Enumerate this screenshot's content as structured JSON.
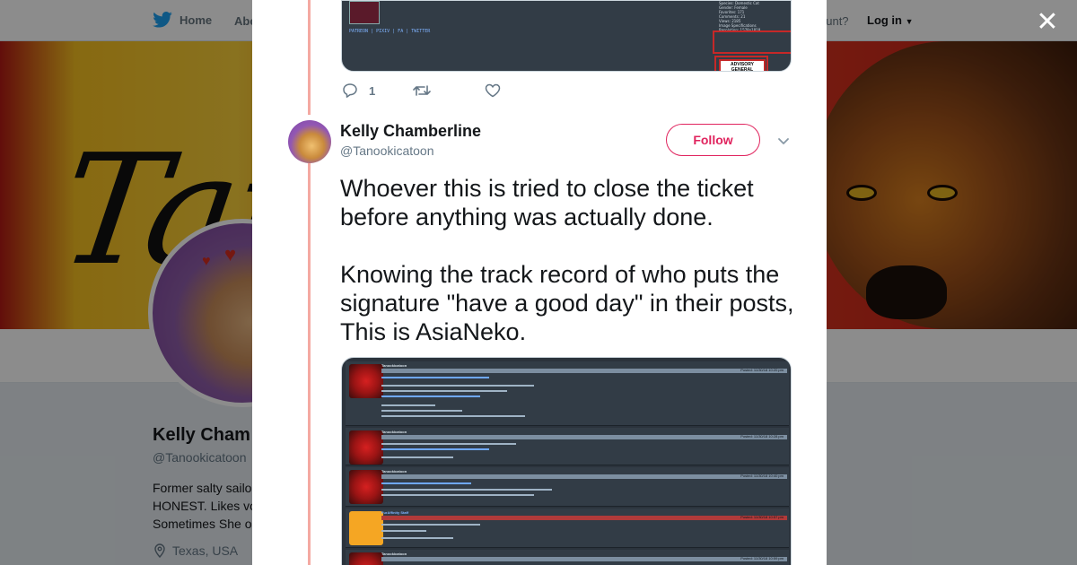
{
  "background": {
    "nav": {
      "home_label": "Home",
      "about_label": "Abo",
      "account_prompt": "ccount?",
      "login_label": "Log in"
    },
    "banner_text": "Tan",
    "profile": {
      "name": "Kelly Cham",
      "handle": "@Tanookicatoon",
      "bio_lines": [
        "Former salty sailo",
        "HONEST. Likes vo",
        "Sometimes She o"
      ],
      "location": "Texas, USA"
    }
  },
  "modal": {
    "close_label": "✕",
    "previous_tweet": {
      "media_links": "PATREON | PIXIV | FA | TWITTER",
      "media_info": [
        "Species: Domestic Cat",
        "Gender: Female",
        "Favorites: 171",
        "Comments: 21",
        "Views: 2185",
        "Image Specifications",
        "Resolution: 1578x1818"
      ],
      "advisory_label": "ADVISORY GENERAL AUDIENCE",
      "reply_count": "1",
      "retweet_count": "",
      "like_count": ""
    },
    "tweet": {
      "author_name": "Kelly Chamberline",
      "author_handle": "@Tanookicatoon",
      "follow_label": "Follow",
      "text": "Whoever this is tried to close the ticket before anything was actually done.\n\nKnowing the track record of who puts the signature \"have a good day\" in their posts, This is AsiaNeko.",
      "media_posts": [
        {
          "user": "Tanookicatoon",
          "date": "Posted: 11/30/18 10:20 pm",
          "avatar": "red"
        },
        {
          "user": "Tanookicatoon",
          "date": "Posted: 11/30/18 10:28 pm",
          "avatar": "red"
        },
        {
          "user": "Tanookicatoon",
          "date": "Posted: 11/30/18 10:40 pm",
          "avatar": "red"
        },
        {
          "user": "FurAffinity Staff",
          "date": "Posted: 11/30/18 10:57 pm",
          "avatar": "staff"
        },
        {
          "user": "Tanookicatoon",
          "date": "Posted: 11/30/18 10:59 pm",
          "avatar": "red"
        }
      ]
    }
  },
  "colors": {
    "accent": "#e0245e",
    "twitter_blue": "#1da1f2",
    "thread_line": "#f4a9a2"
  }
}
